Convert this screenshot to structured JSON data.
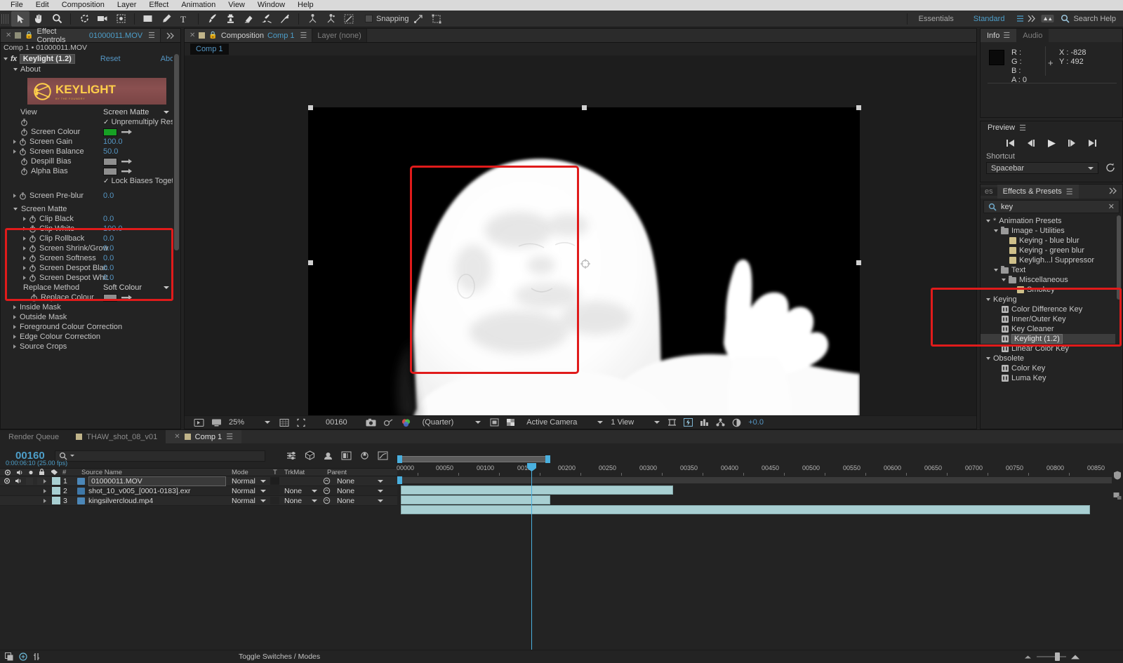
{
  "menu": {
    "items": [
      "File",
      "Edit",
      "Composition",
      "Layer",
      "Effect",
      "Animation",
      "View",
      "Window",
      "Help"
    ]
  },
  "toolbar": {
    "tools": [
      {
        "name": "selection-tool",
        "title": "Selection Tool",
        "selected": true
      },
      {
        "name": "hand-tool",
        "title": "Hand Tool",
        "selected": false
      },
      {
        "name": "zoom-tool",
        "title": "Zoom Tool",
        "selected": false
      },
      {
        "name": "rotation-tool",
        "title": "Rotation Tool",
        "selected": false
      },
      {
        "name": "camera-tool",
        "title": "Camera Tool",
        "selected": false
      },
      {
        "name": "pan-behind-tool",
        "title": "Pan Behind Tool",
        "selected": false
      },
      {
        "name": "shape-tool",
        "title": "Rectangle Tool",
        "selected": false
      },
      {
        "name": "pen-tool",
        "title": "Pen Tool",
        "selected": false
      },
      {
        "name": "type-tool",
        "title": "Type Tool",
        "selected": false
      },
      {
        "name": "brush-tool",
        "title": "Brush Tool",
        "selected": false
      },
      {
        "name": "clone-stamp-tool",
        "title": "Clone Stamp Tool",
        "selected": false
      },
      {
        "name": "eraser-tool",
        "title": "Eraser Tool",
        "selected": false
      },
      {
        "name": "roto-brush-tool",
        "title": "Roto Brush Tool",
        "selected": false
      },
      {
        "name": "puppet-pin-tool",
        "title": "Puppet Pin Tool",
        "selected": false
      }
    ],
    "snapping_label": "Snapping",
    "snapping_checked": false,
    "workspace_label": "Essentials",
    "workspace_active": "Standard",
    "search_help_placeholder": "Search Help"
  },
  "effect_controls": {
    "tab_label": "Effect Controls",
    "tab_file": "01000011.MOV",
    "breadcrumb": "Comp 1 • 01000011.MOV",
    "effect_name": "Keylight (1.2)",
    "reset_label": "Reset",
    "about_link_label": "Abo",
    "about_section": "About",
    "logo_title": "KEYLIGHT",
    "logo_subtitle": "BY THE FOUNDRY",
    "properties": [
      {
        "label": "View",
        "value": "Screen Matte",
        "type": "dropdown",
        "indent": 1
      },
      {
        "label": "Unpremultiply Resul",
        "value": "",
        "type": "checkbox",
        "checked": true,
        "indent": 1
      },
      {
        "label": "Screen Colour",
        "value": "",
        "type": "color",
        "color": "#17a124",
        "indent": 1
      },
      {
        "label": "Screen Gain",
        "value": "100.0",
        "type": "number",
        "indent": 1,
        "expandable": true
      },
      {
        "label": "Screen Balance",
        "value": "50.0",
        "type": "number",
        "indent": 1,
        "expandable": true
      },
      {
        "label": "Despill Bias",
        "value": "",
        "type": "color",
        "color": "#8f8f8f",
        "indent": 1
      },
      {
        "label": "Alpha Bias",
        "value": "",
        "type": "color",
        "color": "#8f8f8f",
        "indent": 1
      },
      {
        "label": "Lock Biases Togeth",
        "value": "",
        "type": "checkbox",
        "checked": true,
        "indent": 1
      },
      {
        "label": "Screen Pre-blur",
        "value": "0.0",
        "type": "number",
        "indent": 1,
        "expandable": true
      }
    ],
    "screen_matte_section": "Screen Matte",
    "screen_matte_props": [
      {
        "label": "Clip Black",
        "value": "0.0"
      },
      {
        "label": "Clip White",
        "value": "100.0"
      },
      {
        "label": "Clip Rollback",
        "value": "0.0"
      },
      {
        "label": "Screen Shrink/Grow",
        "value": "0.0"
      },
      {
        "label": "Screen Softness",
        "value": "0.0"
      },
      {
        "label": "Screen Despot Blac",
        "value": "0.0"
      },
      {
        "label": "Screen Despot Whit",
        "value": "0.0"
      }
    ],
    "replace_method_label": "Replace Method",
    "replace_method_value": "Soft Colour",
    "replace_colour_label": "Replace Colour",
    "replace_colour": "#8f8f8f",
    "collapsed_sections": [
      "Inside Mask",
      "Outside Mask",
      "Foreground Colour Correction",
      "Edge Colour Correction",
      "Source Crops"
    ]
  },
  "composition": {
    "tab_label": "Composition",
    "tab_name": "Comp 1",
    "layer_tab_label": "Layer (none)",
    "breadcrumb": "Comp 1",
    "zoom": "25%",
    "timecode": "00160",
    "resolution": "(Quarter)",
    "camera": "Active Camera",
    "views": "1 View",
    "exposure": "+0.0"
  },
  "info": {
    "tab_label": "Info",
    "audio_tab_label": "Audio",
    "r_label": "R :",
    "g_label": "G :",
    "b_label": "B :",
    "a_label": "A :",
    "r_value": "",
    "g_value": "",
    "b_value": "",
    "a_value": "0",
    "x_label": "X :",
    "x_value": "-828",
    "y_label": "Y :",
    "y_value": "492"
  },
  "preview": {
    "title": "Preview",
    "shortcut_label": "Shortcut",
    "shortcut_value": "Spacebar"
  },
  "effects_presets": {
    "ghost_tab": "es",
    "tab_label": "Effects & Presets",
    "search_value": "key",
    "tree": [
      {
        "label": "Animation Presets",
        "depth": 0,
        "type": "root",
        "open": true
      },
      {
        "label": "Image - Utilities",
        "depth": 1,
        "type": "folder",
        "open": true
      },
      {
        "label": "Keying - blue blur",
        "depth": 2,
        "type": "preset"
      },
      {
        "label": "Keying - green blur",
        "depth": 2,
        "type": "preset"
      },
      {
        "label": "Keyligh...l Suppressor",
        "depth": 2,
        "type": "preset"
      },
      {
        "label": "Text",
        "depth": 1,
        "type": "folder",
        "open": true
      },
      {
        "label": "Miscellaneous",
        "depth": 2,
        "type": "folder",
        "open": true
      },
      {
        "label": "Smokey",
        "depth": 3,
        "type": "preset"
      },
      {
        "label": "Keying",
        "depth": 0,
        "type": "group",
        "open": true
      },
      {
        "label": "Color Difference Key",
        "depth": 1,
        "type": "effect"
      },
      {
        "label": "Inner/Outer Key",
        "depth": 1,
        "type": "effect"
      },
      {
        "label": "Key Cleaner",
        "depth": 1,
        "type": "effect"
      },
      {
        "label": "Keylight (1.2)",
        "depth": 1,
        "type": "effect",
        "selected": true
      },
      {
        "label": "Linear Color Key",
        "depth": 1,
        "type": "effect"
      },
      {
        "label": "Obsolete",
        "depth": 0,
        "type": "group",
        "open": true
      },
      {
        "label": "Color Key",
        "depth": 1,
        "type": "effect"
      },
      {
        "label": "Luma Key",
        "depth": 1,
        "type": "effect"
      }
    ]
  },
  "timeline": {
    "render_queue_tab": "Render Queue",
    "project_tab": "THAW_shot_08_v01",
    "comp_tab": "Comp 1",
    "current_frame": "00160",
    "current_timecode": "0:00:06:10 (25.00 fps)",
    "columns": [
      "#",
      "Source Name",
      "Mode",
      "T",
      "TrkMat",
      "Parent"
    ],
    "layers": [
      {
        "index": "1",
        "name": "01000011.MOV",
        "mode": "Normal",
        "trkmat": "",
        "parent": "None",
        "selected": true,
        "icon_color": "#4c87b8"
      },
      {
        "index": "2",
        "name": "shot_10_v005_[0001-0183].exr",
        "mode": "Normal",
        "trkmat": "None",
        "parent": "None",
        "selected": false,
        "icon_color": "#3f78a8"
      },
      {
        "index": "3",
        "name": "kingsilvercloud.mp4",
        "mode": "Normal",
        "trkmat": "None",
        "parent": "None",
        "selected": false,
        "icon_color": "#4c87b8"
      }
    ],
    "ruler_ticks": [
      "00000",
      "00050",
      "00100",
      "00150",
      "00200",
      "00250",
      "00300",
      "00350",
      "00400",
      "00450",
      "00500",
      "00550",
      "00600",
      "00650",
      "00700",
      "00750",
      "00800",
      "00850"
    ],
    "toggle_switches_label": "Toggle Switches / Modes"
  }
}
